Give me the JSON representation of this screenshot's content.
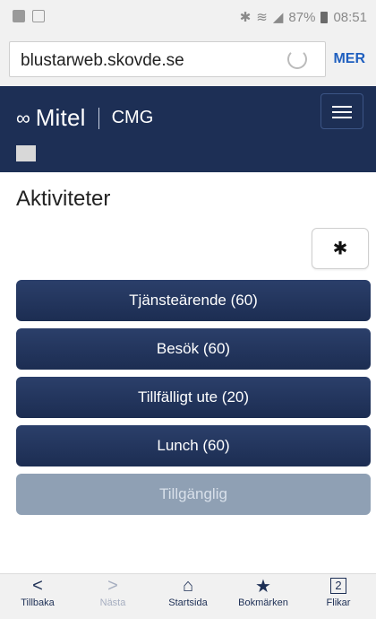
{
  "status_bar": {
    "battery": "87%",
    "time": "08:51",
    "icons": [
      "notification-icon",
      "message-icon",
      "bluetooth-icon",
      "wifi-icon",
      "signal-icon",
      "battery-icon"
    ]
  },
  "browser": {
    "url": "blustarweb.skovde.se",
    "more_label": "MER"
  },
  "header": {
    "brand": "Mitel",
    "product": "CMG",
    "menu_icon": "hamburger-icon"
  },
  "main": {
    "title": "Aktiviteter",
    "settings_icon": "gear-icon",
    "activities": [
      {
        "label": "Tjänsteärende (60)"
      },
      {
        "label": "Besök (60)"
      },
      {
        "label": "Tillfälligt ute (20)"
      },
      {
        "label": "Lunch (60)"
      },
      {
        "label": "Tillgänglig"
      }
    ]
  },
  "bottom_nav": {
    "items": [
      {
        "label": "Tillbaka",
        "icon": "back-arrow-icon"
      },
      {
        "label": "Nästa",
        "icon": "forward-arrow-icon"
      },
      {
        "label": "Startsida",
        "icon": "home-icon"
      },
      {
        "label": "Bokmärken",
        "icon": "bookmark-icon"
      },
      {
        "label": "Flikar",
        "icon": "tabs-icon",
        "count": "2"
      }
    ]
  },
  "colors": {
    "header_bg": "#1d2f55",
    "button_bg": "#1f3059",
    "button_disabled_bg": "#8fa0b4",
    "link": "#1f5fbf"
  }
}
